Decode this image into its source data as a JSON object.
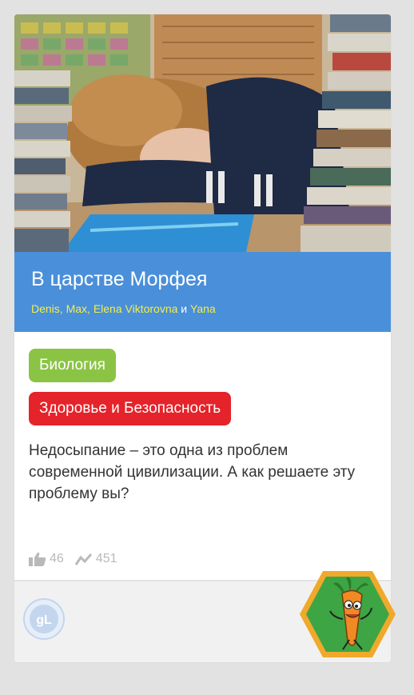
{
  "card": {
    "title": "В царстве Морфея",
    "authors": [
      "Denis",
      "Max",
      "Elena Viktorovna",
      "Yana"
    ],
    "separators": [
      ", ",
      ", ",
      " и "
    ],
    "tags": [
      {
        "label": "Биология",
        "color": "#8bc445"
      },
      {
        "label": "Здоровье и Безопасность",
        "color": "#e4232a"
      }
    ],
    "description": "Недосыпание – это одна из проблем современной цивилизации. А как решаете эту проблему вы?",
    "stats": {
      "likes": "46",
      "views": "451"
    },
    "icons": {
      "like": "thumbs-up-icon",
      "views": "trend-line-icon",
      "logo": "gl-logo-icon",
      "mascot": "carrot-mascot-icon"
    }
  },
  "colors": {
    "title_band": "#4a8fd9",
    "author_link": "#f3ee4a",
    "page_background": "#e2e2e2",
    "stats_text": "#b9b9b9"
  }
}
